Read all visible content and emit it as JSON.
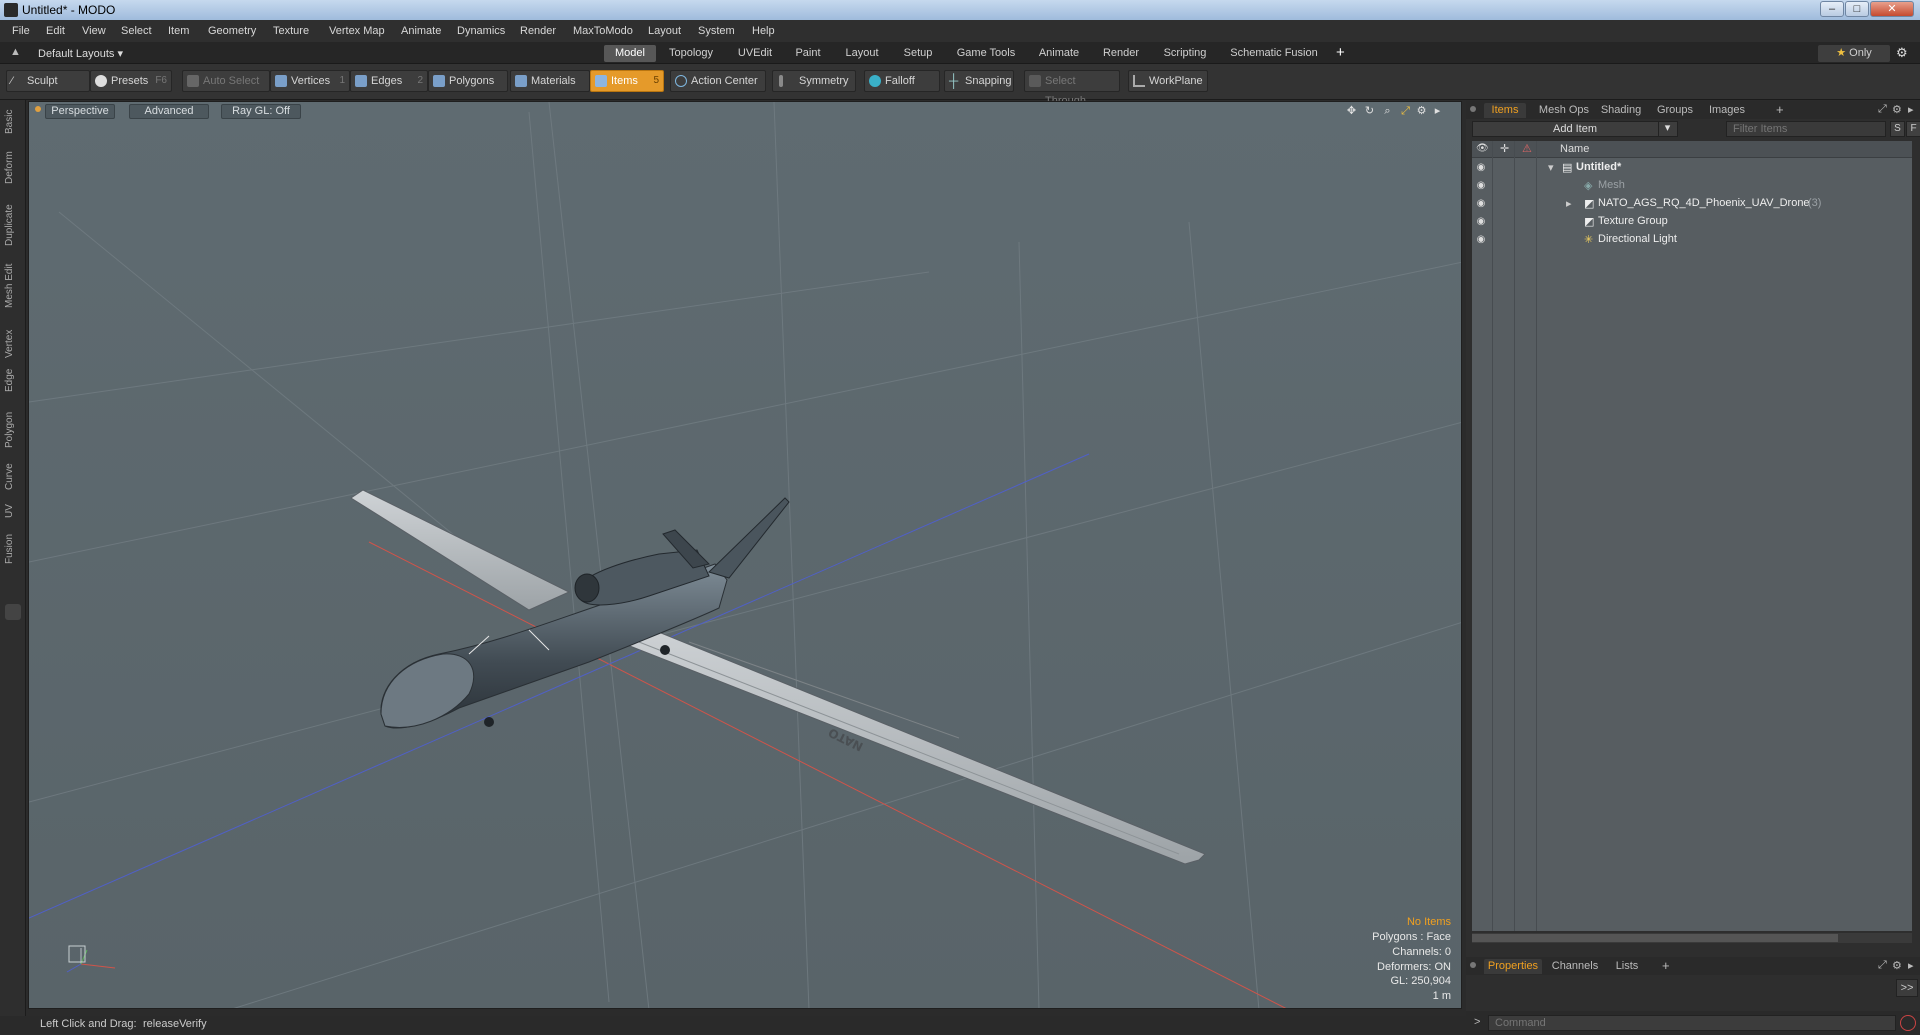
{
  "window": {
    "title": "Untitled* - MODO"
  },
  "menu": [
    "File",
    "Edit",
    "View",
    "Select",
    "Item",
    "Geometry",
    "Texture",
    "Vertex Map",
    "Animate",
    "Dynamics",
    "Render",
    "MaxToModo",
    "Layout",
    "System",
    "Help"
  ],
  "layout_selector": "Default Layouts",
  "layout_tabs": [
    "Model",
    "Topology",
    "UVEdit",
    "Paint",
    "Layout",
    "Setup",
    "Game Tools",
    "Animate",
    "Render",
    "Scripting",
    "Schematic Fusion"
  ],
  "layout_tabs_active": "Model",
  "only_label": "Only",
  "toolbar": {
    "sculpt": "Sculpt",
    "presets": "Presets",
    "presets_key": "F6",
    "auto_select": "Auto Select",
    "vertices": "Vertices",
    "vertices_key": "1",
    "edges": "Edges",
    "edges_key": "2",
    "polygons": "Polygons",
    "materials": "Materials",
    "items": "Items",
    "items_key": "5",
    "action_center": "Action Center",
    "symmetry": "Symmetry",
    "falloff": "Falloff",
    "snapping": "Snapping",
    "select_through": "Select Through",
    "workplane": "WorkPlane"
  },
  "side_tabs": [
    "Basic",
    "Deform",
    "Duplicate",
    "Mesh Edit",
    "Vertex",
    "Edge",
    "Polygon",
    "Curve",
    "UV",
    "Fusion"
  ],
  "viewport": {
    "view": "Perspective",
    "advanced": "Advanced",
    "raygl": "Ray GL: Off",
    "wing_marking": "NATO",
    "hud": {
      "selection": "No Items",
      "polygons": "Polygons : Face",
      "channels": "Channels: 0",
      "deformers": "Deformers: ON",
      "gl": "GL: 250,904",
      "scale": "1 m"
    }
  },
  "items_panel": {
    "tabs": [
      "Items",
      "Mesh Ops",
      "Shading",
      "Groups",
      "Images"
    ],
    "active_tab": "Items",
    "add_item": "Add Item",
    "filter_placeholder": "Filter Items",
    "s_label": "S",
    "f_label": "F",
    "name_header": "Name",
    "tree": [
      {
        "label": "Untitled*",
        "bold": true
      },
      {
        "label": "Mesh",
        "dim": true
      },
      {
        "label": "NATO_AGS_RQ_4D_Phoenix_UAV_Drone",
        "count": "(3)"
      },
      {
        "label": "Texture Group"
      },
      {
        "label": "Directional Light"
      }
    ]
  },
  "properties_panel": {
    "tabs": [
      "Properties",
      "Channels",
      "Lists"
    ],
    "active_tab": "Properties",
    "expand": ">>"
  },
  "command_placeholder": "Command",
  "status": {
    "hint": "Left Click and Drag:",
    "action": "releaseVerify"
  },
  "colors": {
    "accent": "#f0a020",
    "viewport_bg": "#5e6a70",
    "active_tool": "#e59a2a"
  }
}
